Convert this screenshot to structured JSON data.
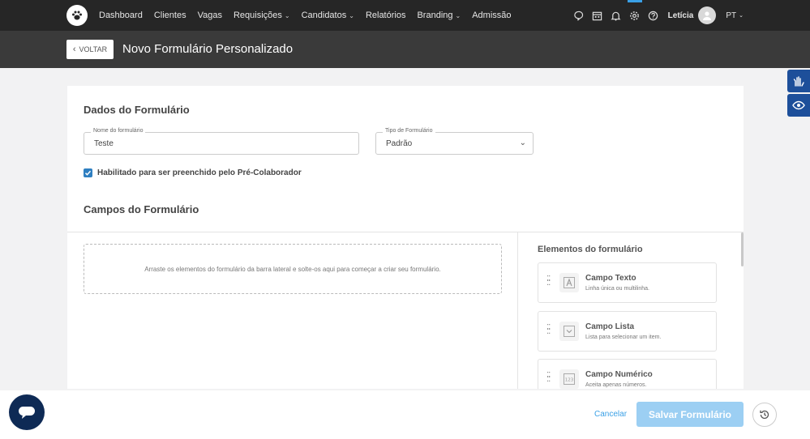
{
  "nav": {
    "items": [
      {
        "label": "Dashboard",
        "has_caret": false
      },
      {
        "label": "Clientes",
        "has_caret": false
      },
      {
        "label": "Vagas",
        "has_caret": false
      },
      {
        "label": "Requisições",
        "has_caret": true
      },
      {
        "label": "Candidatos",
        "has_caret": true
      },
      {
        "label": "Relatórios",
        "has_caret": false
      },
      {
        "label": "Branding",
        "has_caret": true
      },
      {
        "label": "Admissão",
        "has_caret": false
      }
    ],
    "icons": [
      "chat-icon",
      "calendar-icon",
      "bell-icon",
      "gear-icon",
      "help-icon"
    ],
    "user_name": "Letícia",
    "language": "PT"
  },
  "header": {
    "back_label": "VOLTAR",
    "title": "Novo Formulário Personalizado"
  },
  "form": {
    "section_title": "Dados do Formulário",
    "name_label": "Nome do formulário",
    "name_value": "Teste",
    "type_label": "Tipo de Formulário",
    "type_value": "Padrão",
    "checkbox_label": "Habilitado para ser preenchido pelo Pré-Colaborador",
    "checkbox_checked": true
  },
  "fields": {
    "section_title": "Campos do Formulário",
    "dropzone_text": "Arraste os elementos do formulário da barra lateral e solte-os aqui para começar a criar seu formulário.",
    "elements_title": "Elementos do formulário",
    "elements": [
      {
        "name": "Campo Texto",
        "desc": "Linha única ou multilinha.",
        "icon": "text-field-icon"
      },
      {
        "name": "Campo Lista",
        "desc": "Lista para selecionar um item.",
        "icon": "list-field-icon"
      },
      {
        "name": "Campo Numérico",
        "desc": "Aceita apenas números.",
        "icon": "number-field-icon"
      }
    ]
  },
  "footer": {
    "cancel_label": "Cancelar",
    "save_label": "Salvar Formulário"
  },
  "colors": {
    "nav_bg": "#262626",
    "subheader_bg": "#3a3a3a",
    "accent": "#3aa0e6",
    "save_button": "#9ccff3",
    "a11y": "#1d4f9a",
    "chat": "#0e2a55"
  }
}
